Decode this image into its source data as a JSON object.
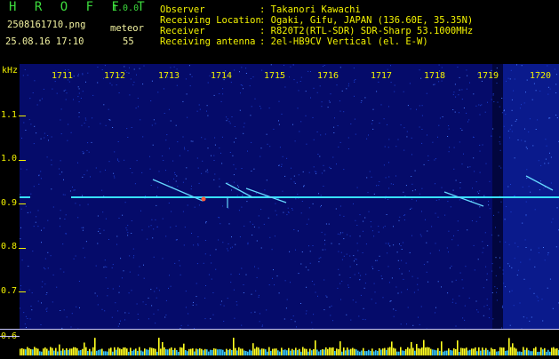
{
  "header": {
    "app_title": "H R O F F T",
    "version": "1.0.0",
    "filename": "2508161710.png",
    "meteor_label": "meteor",
    "date_time": "25.08.16 17:10",
    "meteor_count": "55",
    "info": [
      {
        "label": "Observer",
        "value": ": Takanori Kawachi"
      },
      {
        "label": "Receiving Location",
        "value": ": Ogaki, Gifu, JAPAN (136.60E, 35.35N)"
      },
      {
        "label": "Receiver",
        "value": ": R820T2(RTL-SDR) SDR-Sharp 53.1000MHz"
      },
      {
        "label": "Receiving antenna",
        "value": ": 2el-HB9CV Vertical (el. E-W)"
      }
    ]
  },
  "spectrogram": {
    "y_unit": "kHz",
    "y_ticks": [
      "1.1",
      "1.0",
      "0.9",
      "0.8",
      "0.7",
      "0.6"
    ],
    "x_ticks": [
      "1711",
      "1712",
      "1713",
      "1714",
      "1715",
      "1716",
      "1717",
      "1718",
      "1719",
      "1720"
    ],
    "colors": {
      "background": "#050b6a",
      "carrier": "#37e0ff",
      "text": "#f2f200",
      "meter": "#ffff20"
    }
  }
}
